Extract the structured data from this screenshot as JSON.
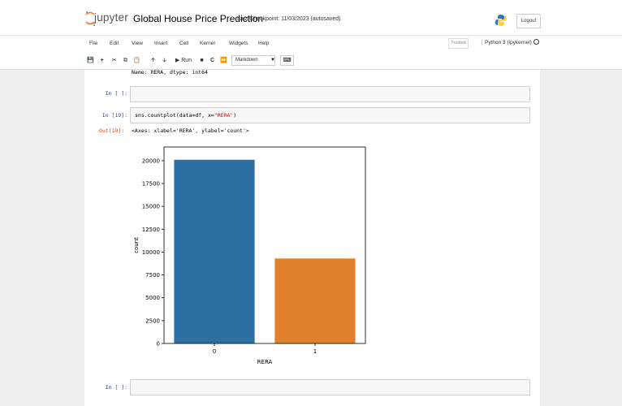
{
  "header": {
    "logo_text": "jupyter",
    "notebook_title": "Global House Price Prediction",
    "checkpoint": "Last Checkpoint: 11/03/2023  (autosaved)",
    "logout_label": "Logout"
  },
  "menubar": {
    "items": [
      "File",
      "Edit",
      "View",
      "Insert",
      "Cell",
      "Kernel",
      "Widgets",
      "Help"
    ],
    "trusted_label": "Trusted",
    "kernel_name": "Python 3 (ipykernel)"
  },
  "toolbar": {
    "run_label": "Run",
    "cell_type": "Markdown"
  },
  "cells": {
    "stdout": "Name: RERA, dtype: int64",
    "empty_prompt_1": "In [ ]:",
    "plot_prompt": "In [19]:",
    "plot_code_prefix": "sns.countplot(data=df, x=",
    "plot_code_string": "\"RERA\"",
    "plot_code_suffix": ")",
    "out_prompt": "Out[19]:",
    "out_text": "<Axes: xlabel='RERA', ylabel='count'>",
    "empty_prompt_2": "In [ ]:"
  },
  "chart_data": {
    "type": "bar",
    "categories": [
      "0",
      "1"
    ],
    "values": [
      20100,
      9300
    ],
    "colors": [
      "#2b6fa3",
      "#e1812c"
    ],
    "xlabel": "RERA",
    "ylabel": "count",
    "ylim": [
      0,
      21500
    ],
    "yticks": [
      0,
      2500,
      5000,
      7500,
      10000,
      12500,
      15000,
      17500,
      20000
    ],
    "grid": false
  }
}
